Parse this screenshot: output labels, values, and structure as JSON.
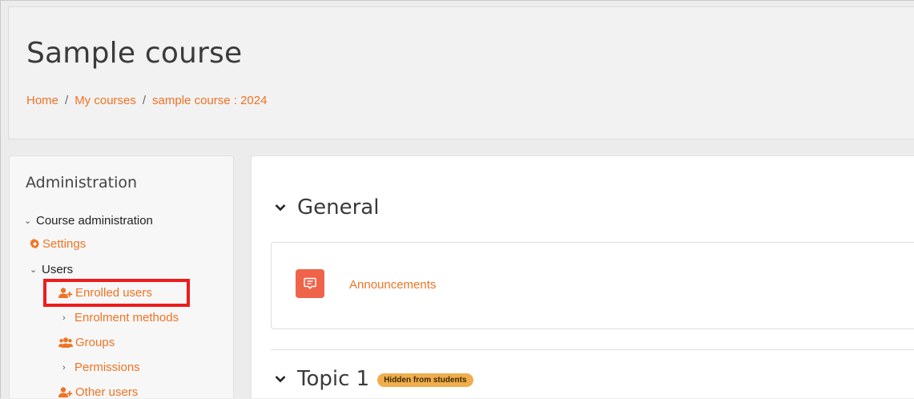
{
  "header": {
    "course_title": "Sample course",
    "breadcrumb": {
      "home": "Home",
      "separator": "/",
      "my_courses": "My courses",
      "course": "sample course : 2024"
    }
  },
  "admin_block": {
    "title": "Administration",
    "course_admin": "Course administration",
    "settings": "Settings",
    "users": "Users",
    "enrolled_users": "Enrolled users",
    "enrolment_methods": "Enrolment methods",
    "groups": "Groups",
    "permissions": "Permissions",
    "other_users": "Other users"
  },
  "main": {
    "section_general": "General",
    "activity_announcements": "Announcements",
    "section_topic1": "Topic 1",
    "topic1_badge": "Hidden from students"
  },
  "colors": {
    "accent": "#f07324",
    "highlight": "#ee1c1c",
    "forum_icon_bg": "#f0634b",
    "badge_bg": "#f0ad4e"
  },
  "icons": {
    "settings": "gear-icon",
    "enrolled_users": "user-plus-icon",
    "groups": "users-icon",
    "other_users": "user-plus-icon",
    "announcements": "forum-icon",
    "expand": "chevron-down-icon",
    "collapse": "chevron-right-icon"
  }
}
